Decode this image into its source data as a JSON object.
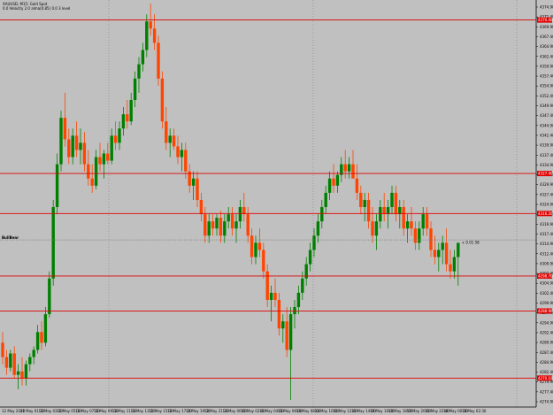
{
  "header": {
    "symbol_line": "XAUUSD, M15: Gold Spot",
    "info_line": "0.0 Velocity 2.0 alma(0.85) 0.0 3 level"
  },
  "bid_tag": "BullBear",
  "trade_label": "+ 0.01 58",
  "colors": {
    "background": "#c0c0c0",
    "bull_candle": "#008000",
    "bear_candle": "#ff4500",
    "level_line": "#e00000",
    "grid": "#808080",
    "bid_line": "#808080"
  },
  "chart_data": {
    "type": "candlestick",
    "y_ticks": [
      "4374.90",
      "4372.40",
      "4369.90",
      "4367.40",
      "4364.90",
      "4362.40",
      "4359.90",
      "4357.40",
      "4354.90",
      "4352.40",
      "4349.90",
      "4347.40",
      "4344.90",
      "4342.40",
      "4339.90",
      "4337.40",
      "4334.90",
      "4332.40",
      "4329.90",
      "4327.40",
      "4324.90",
      "4322.40",
      "4319.90",
      "4317.40",
      "4314.90",
      "4312.40",
      "4309.90",
      "4307.40",
      "4304.90",
      "4302.40",
      "4299.90",
      "4297.40",
      "4294.90",
      "4292.40",
      "4289.90",
      "4287.40",
      "4284.90",
      "4282.40",
      "4279.90",
      "4277.40",
      "4274.90"
    ],
    "x_ticks": [
      "12 May 2026",
      "12 May 01:30",
      "12 May 03:30",
      "12 May 05:30",
      "12 May 07:30",
      "12 May 09:30",
      "12 May 11:30",
      "12 May 13:30",
      "12 May 15:30",
      "12 May 17:30",
      "12 May 19:30",
      "12 May 21:30",
      "13 May 00:00",
      "13 May 02:00",
      "13 May 04:00",
      "13 May 06:00",
      "13 May 08:00",
      "13 May 10:00",
      "13 May 12:00",
      "13 May 14:00",
      "13 May 16:00",
      "13 May 18:00",
      "13 May 20:00",
      "13 May 22:00",
      "14 May 00:30",
      "14 May 02:30"
    ],
    "levels": [
      {
        "label": "4370.40",
        "value": 4370.4
      },
      {
        "label": "4327.40",
        "value": 4327.4
      },
      {
        "label": "4316.20",
        "value": 4316.2
      },
      {
        "label": "4298.70",
        "value": 4298.7
      },
      {
        "label": "4288.90",
        "value": 4288.9
      },
      {
        "label": "4270.10",
        "value": 4270.1
      }
    ],
    "bid": 4308.8,
    "ylim": [
      4262.0,
      4376.0
    ],
    "candles": [
      [
        4280,
        4283,
        4274,
        4276
      ],
      [
        4276,
        4278,
        4271,
        4273
      ],
      [
        4273,
        4278,
        4272,
        4277
      ],
      [
        4277,
        4279,
        4270,
        4271
      ],
      [
        4271,
        4274,
        4267,
        4272
      ],
      [
        4272,
        4276,
        4268,
        4270
      ],
      [
        4270,
        4275,
        4268,
        4274
      ],
      [
        4274,
        4277,
        4272,
        4276
      ],
      [
        4276,
        4279,
        4274,
        4278
      ],
      [
        4278,
        4285,
        4277,
        4283
      ],
      [
        4283,
        4286,
        4278,
        4280
      ],
      [
        4280,
        4290,
        4279,
        4288
      ],
      [
        4288,
        4300,
        4287,
        4298
      ],
      [
        4298,
        4320,
        4296,
        4318
      ],
      [
        4318,
        4333,
        4316,
        4330
      ],
      [
        4330,
        4345,
        4328,
        4343
      ],
      [
        4343,
        4350,
        4335,
        4337
      ],
      [
        4337,
        4340,
        4330,
        4332
      ],
      [
        4332,
        4340,
        4330,
        4338
      ],
      [
        4338,
        4342,
        4332,
        4334
      ],
      [
        4334,
        4340,
        4330,
        4336
      ],
      [
        4336,
        4339,
        4328,
        4330
      ],
      [
        4330,
        4334,
        4324,
        4326
      ],
      [
        4326,
        4330,
        4322,
        4324
      ],
      [
        4324,
        4334,
        4323,
        4332
      ],
      [
        4332,
        4336,
        4328,
        4330
      ],
      [
        4330,
        4334,
        4326,
        4333
      ],
      [
        4333,
        4336,
        4330,
        4331
      ],
      [
        4331,
        4340,
        4330,
        4338
      ],
      [
        4338,
        4342,
        4334,
        4336
      ],
      [
        4336,
        4342,
        4334,
        4340
      ],
      [
        4340,
        4346,
        4338,
        4344
      ],
      [
        4344,
        4348,
        4340,
        4342
      ],
      [
        4342,
        4350,
        4341,
        4348
      ],
      [
        4348,
        4356,
        4346,
        4354
      ],
      [
        4354,
        4360,
        4350,
        4358
      ],
      [
        4358,
        4364,
        4356,
        4362
      ],
      [
        4362,
        4372,
        4360,
        4370
      ],
      [
        4370,
        4375,
        4366,
        4368
      ],
      [
        4368,
        4372,
        4362,
        4364
      ],
      [
        4364,
        4366,
        4352,
        4354
      ],
      [
        4354,
        4356,
        4340,
        4342
      ],
      [
        4342,
        4346,
        4334,
        4336
      ],
      [
        4336,
        4340,
        4332,
        4338
      ],
      [
        4338,
        4340,
        4334,
        4335
      ],
      [
        4335,
        4338,
        4330,
        4332
      ],
      [
        4332,
        4336,
        4328,
        4334
      ],
      [
        4334,
        4336,
        4326,
        4328
      ],
      [
        4328,
        4330,
        4322,
        4324
      ],
      [
        4324,
        4328,
        4320,
        4326
      ],
      [
        4326,
        4328,
        4318,
        4320
      ],
      [
        4320,
        4322,
        4314,
        4316
      ],
      [
        4316,
        4318,
        4308,
        4310
      ],
      [
        4310,
        4316,
        4308,
        4314
      ],
      [
        4314,
        4316,
        4310,
        4312
      ],
      [
        4312,
        4316,
        4310,
        4315
      ],
      [
        4315,
        4317,
        4308,
        4310
      ],
      [
        4310,
        4316,
        4308,
        4314
      ],
      [
        4314,
        4318,
        4312,
        4316
      ],
      [
        4316,
        4318,
        4310,
        4312
      ],
      [
        4312,
        4316,
        4308,
        4314
      ],
      [
        4314,
        4320,
        4312,
        4318
      ],
      [
        4318,
        4322,
        4314,
        4316
      ],
      [
        4316,
        4318,
        4308,
        4310
      ],
      [
        4310,
        4312,
        4302,
        4304
      ],
      [
        4304,
        4310,
        4302,
        4308
      ],
      [
        4308,
        4312,
        4304,
        4306
      ],
      [
        4306,
        4308,
        4298,
        4300
      ],
      [
        4300,
        4302,
        4290,
        4292
      ],
      [
        4292,
        4296,
        4286,
        4294
      ],
      [
        4294,
        4298,
        4290,
        4292
      ],
      [
        4292,
        4294,
        4282,
        4284
      ],
      [
        4284,
        4288,
        4280,
        4286
      ],
      [
        4286,
        4290,
        4276,
        4278
      ],
      [
        4278,
        4290,
        4264,
        4288
      ],
      [
        4288,
        4292,
        4284,
        4290
      ],
      [
        4290,
        4296,
        4288,
        4294
      ],
      [
        4294,
        4300,
        4292,
        4298
      ],
      [
        4298,
        4304,
        4296,
        4302
      ],
      [
        4302,
        4308,
        4300,
        4306
      ],
      [
        4306,
        4312,
        4304,
        4310
      ],
      [
        4310,
        4316,
        4308,
        4314
      ],
      [
        4314,
        4320,
        4312,
        4318
      ],
      [
        4318,
        4324,
        4316,
        4322
      ],
      [
        4322,
        4328,
        4320,
        4326
      ],
      [
        4326,
        4330,
        4322,
        4324
      ],
      [
        4324,
        4328,
        4322,
        4327
      ],
      [
        4327,
        4332,
        4325,
        4330
      ],
      [
        4330,
        4334,
        4326,
        4328
      ],
      [
        4328,
        4332,
        4326,
        4330
      ],
      [
        4330,
        4334,
        4328,
        4326
      ],
      [
        4326,
        4330,
        4320,
        4322
      ],
      [
        4322,
        4324,
        4316,
        4318
      ],
      [
        4318,
        4322,
        4314,
        4320
      ],
      [
        4320,
        4322,
        4312,
        4314
      ],
      [
        4314,
        4318,
        4308,
        4310
      ],
      [
        4310,
        4316,
        4306,
        4314
      ],
      [
        4314,
        4320,
        4312,
        4318
      ],
      [
        4318,
        4322,
        4314,
        4316
      ],
      [
        4316,
        4320,
        4312,
        4318
      ],
      [
        4318,
        4324,
        4316,
        4322
      ],
      [
        4322,
        4324,
        4314,
        4316
      ],
      [
        4316,
        4320,
        4312,
        4318
      ],
      [
        4318,
        4320,
        4310,
        4312
      ],
      [
        4312,
        4316,
        4308,
        4314
      ],
      [
        4314,
        4318,
        4310,
        4312
      ],
      [
        4312,
        4314,
        4306,
        4308
      ],
      [
        4308,
        4314,
        4306,
        4312
      ],
      [
        4312,
        4318,
        4310,
        4316
      ],
      [
        4316,
        4318,
        4310,
        4312
      ],
      [
        4312,
        4314,
        4304,
        4306
      ],
      [
        4306,
        4310,
        4302,
        4304
      ],
      [
        4304,
        4308,
        4300,
        4306
      ],
      [
        4306,
        4310,
        4302,
        4308
      ],
      [
        4308,
        4312,
        4300,
        4302
      ],
      [
        4302,
        4306,
        4298,
        4300
      ],
      [
        4300,
        4306,
        4298,
        4304
      ],
      [
        4304,
        4306,
        4296,
        4308
      ]
    ]
  }
}
